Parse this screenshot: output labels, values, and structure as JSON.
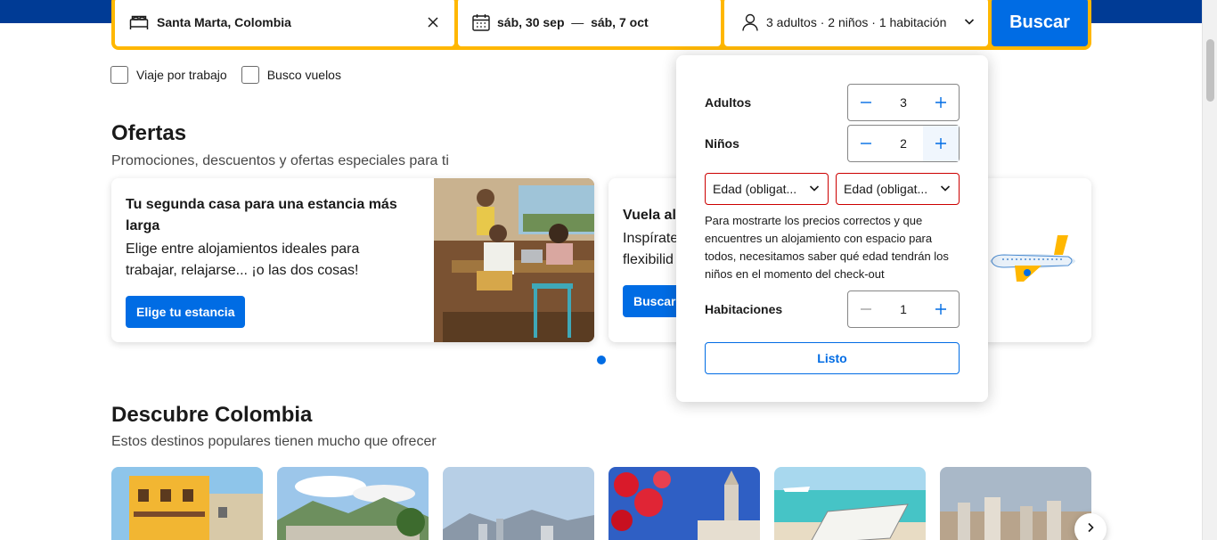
{
  "search": {
    "destination": "Santa Marta, Colombia",
    "date_start": "sáb, 30 sep",
    "date_sep": "—",
    "date_end": "sáb, 7 oct",
    "guests_summary": "3 adultos · 2 niños · 1 habitación",
    "search_label": "Buscar"
  },
  "options": {
    "work_trip": "Viaje por trabajo",
    "flights": "Busco vuelos"
  },
  "offers": {
    "title": "Ofertas",
    "subtitle": "Promociones, descuentos y ofertas especiales para ti",
    "cards": [
      {
        "title": "Tu segunda casa para una estancia más larga",
        "desc": "Elige entre alojamientos ideales para trabajar, relajarse... ¡o las dos cosas!",
        "button": "Elige tu estancia"
      },
      {
        "title": "Vuela al",
        "desc_line1": "Inspírate",
        "desc_line2": "flexibilid",
        "button": "Buscar v"
      }
    ]
  },
  "discover": {
    "title": "Descubre Colombia",
    "subtitle": "Estos destinos populares tienen mucho que ofrecer"
  },
  "guests_popover": {
    "adults_label": "Adultos",
    "adults_value": "3",
    "children_label": "Niños",
    "children_value": "2",
    "age_placeholder": "Edad (obligat...",
    "age_note": "Para mostrarte los precios correctos y que encuentres un alojamiento con espacio para todos, necesitamos saber qué edad tendrán los niños en el momento del check-out",
    "rooms_label": "Habitaciones",
    "rooms_value": "1",
    "done_label": "Listo"
  },
  "colors": {
    "brand_blue": "#003b95",
    "action_blue": "#006ce4",
    "search_yellow": "#ffb700",
    "error_red": "#cc0000"
  }
}
